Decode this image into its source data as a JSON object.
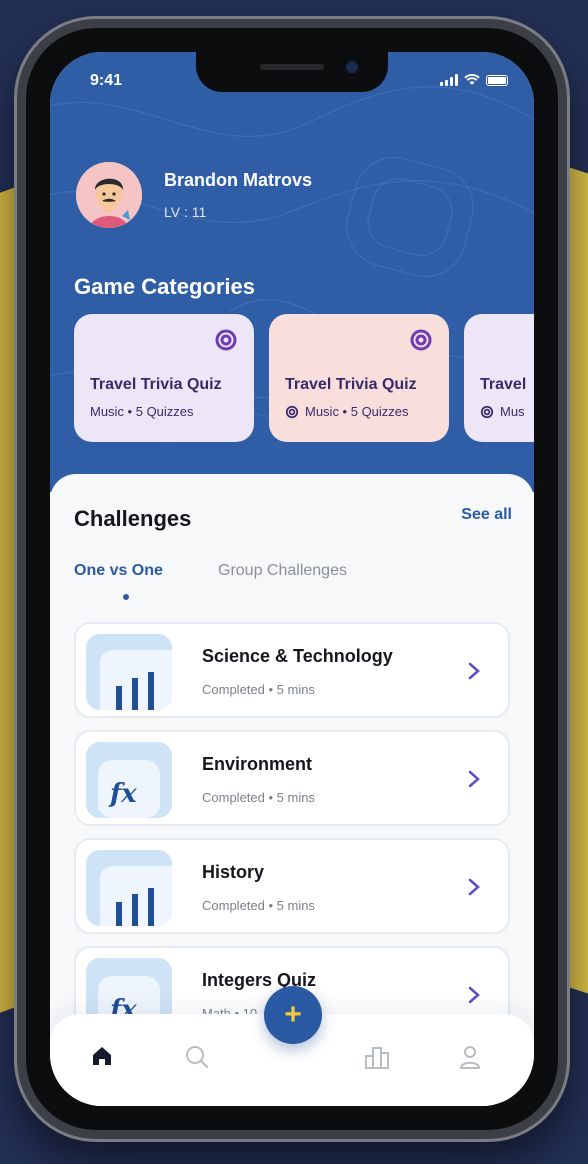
{
  "status": {
    "time": "9:41"
  },
  "user": {
    "name": "Brandon Matrovs",
    "level": "LV : 11"
  },
  "categories": {
    "title": "Game Categories",
    "items": [
      {
        "title": "Travel Trivia Quiz",
        "meta": "Music • 5 Quizzes",
        "color": "#ece6f6"
      },
      {
        "title": "Travel Trivia Quiz",
        "meta": "Music • 5 Quizzes",
        "color": "#f8dfdc"
      },
      {
        "title": "Travel",
        "meta": "Mus",
        "color": "#ece6f6"
      }
    ]
  },
  "challenges": {
    "title": "Challenges",
    "see_all": "See all",
    "tabs": [
      "One vs One",
      "Group Challenges"
    ],
    "items": [
      {
        "name": "Science & Technology",
        "sub": "Completed • 5 mins",
        "icon": "bar-chart-icon"
      },
      {
        "name": "Environment",
        "sub": "Completed • 5 mins",
        "icon": "fx-icon"
      },
      {
        "name": "History",
        "sub": "Completed • 5 mins",
        "icon": "bar-chart-icon"
      },
      {
        "name": "Integers Quiz",
        "sub": "Math • 10",
        "icon": "fx-icon"
      }
    ]
  },
  "fab": {
    "label": "+"
  },
  "colors": {
    "primary": "#2a5aa3",
    "header": "#2f5ea6",
    "accent": "#f3c83e",
    "category_text": "#3b2a6b"
  }
}
